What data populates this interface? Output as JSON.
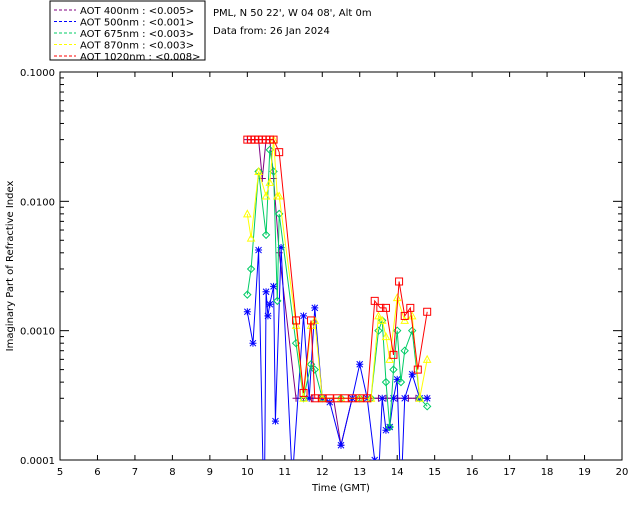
{
  "header": {
    "site_line": "PML, N 50 22', W 04 08', Alt 0m",
    "date_line": "Data from: 26 Jan 2024"
  },
  "legend": [
    {
      "label": "AOT  400nm : <0.005>",
      "color": "#800080"
    },
    {
      "label": "AOT  500nm : <0.001>",
      "color": "#0000ff"
    },
    {
      "label": "AOT  675nm : <0.003>",
      "color": "#00cc66"
    },
    {
      "label": "AOT  870nm : <0.003>",
      "color": "#ffff00"
    },
    {
      "label": "AOT 1020nm : <0.008>",
      "color": "#ff0000"
    }
  ],
  "chart_data": {
    "type": "line",
    "xlabel": "Time (GMT)",
    "ylabel": "Imaginary Part of Refractive Index",
    "x_scale": "linear",
    "y_scale": "log",
    "xlim": [
      5,
      20
    ],
    "ylim": [
      0.0001,
      0.1
    ],
    "x_ticks": [
      "5",
      "6",
      "7",
      "8",
      "9",
      "10",
      "11",
      "12",
      "13",
      "14",
      "15",
      "16",
      "17",
      "18",
      "19",
      "20"
    ],
    "y_ticks": [
      {
        "value": 0.1,
        "label": "0.1000"
      },
      {
        "value": 0.01,
        "label": "0.0100"
      },
      {
        "value": 0.001,
        "label": "0.0010"
      },
      {
        "value": 0.0001,
        "label": "0.0001"
      }
    ],
    "grid": false,
    "legend_position": "top-left, above plot",
    "series": [
      {
        "name": "AOT  400nm : <0.005>",
        "color": "#800080",
        "marker": "plus",
        "x": [
          10.0,
          10.1,
          10.2,
          10.3,
          10.4,
          10.5,
          10.6,
          10.7,
          10.85,
          11.3,
          11.5,
          11.75,
          12.0,
          12.3,
          12.5,
          12.8,
          13.0,
          13.3,
          13.5,
          13.7,
          14.0,
          14.3,
          14.5,
          14.8
        ],
        "y": [
          0.03,
          0.03,
          0.03,
          0.03,
          0.015,
          0.03,
          0.03,
          0.015,
          0.004,
          0.0003,
          0.0003,
          0.0003,
          0.0003,
          0.0003,
          0.00013,
          0.0003,
          0.0003,
          0.0003,
          0.0003,
          0.0003,
          0.0003,
          0.0003,
          0.0003,
          0.0003
        ]
      },
      {
        "name": "AOT  500nm : <0.001>",
        "color": "#0000ff",
        "marker": "asterisk",
        "x": [
          10.0,
          10.15,
          10.3,
          10.45,
          10.5,
          10.55,
          10.6,
          10.7,
          10.75,
          10.9,
          11.2,
          11.5,
          11.65,
          11.8,
          12.0,
          12.2,
          12.5,
          12.8,
          13.0,
          13.2,
          13.4,
          13.5,
          13.6,
          13.7,
          13.8,
          13.9,
          14.0,
          14.1,
          14.2,
          14.4,
          14.6,
          14.8
        ],
        "y": [
          0.0014,
          0.0008,
          0.0042,
          3e-05,
          0.002,
          0.0013,
          0.0016,
          0.0022,
          0.0002,
          0.0044,
          7e-05,
          0.0013,
          0.0003,
          0.0015,
          0.0003,
          0.00028,
          0.00013,
          0.0003,
          0.00055,
          0.0003,
          0.0001,
          7e-05,
          0.0003,
          0.00017,
          0.00018,
          0.0003,
          0.00042,
          5e-05,
          0.0003,
          0.00046,
          0.0003,
          0.0003
        ]
      },
      {
        "name": "AOT  675nm : <0.003>",
        "color": "#00cc66",
        "marker": "diamond",
        "x": [
          10.0,
          10.1,
          10.3,
          10.5,
          10.6,
          10.7,
          10.8,
          10.85,
          11.3,
          11.5,
          11.7,
          11.8,
          12.0,
          12.5,
          13.0,
          13.3,
          13.5,
          13.6,
          13.7,
          13.8,
          13.9,
          14.0,
          14.1,
          14.2,
          14.4,
          14.6,
          14.8
        ],
        "y": [
          0.0019,
          0.003,
          0.017,
          0.0055,
          0.025,
          0.017,
          0.0017,
          0.008,
          0.0008,
          0.0003,
          0.00055,
          0.0005,
          0.0003,
          0.0003,
          0.0003,
          0.0003,
          0.001,
          0.0012,
          0.0004,
          0.00018,
          0.0005,
          0.001,
          0.0004,
          0.0007,
          0.001,
          0.0003,
          0.00026
        ]
      },
      {
        "name": "AOT  870nm : <0.003>",
        "color": "#ffff00",
        "marker": "triangle",
        "x": [
          10.0,
          10.1,
          10.3,
          10.5,
          10.6,
          10.7,
          10.8,
          10.85,
          11.3,
          11.5,
          11.7,
          11.8,
          12.0,
          12.5,
          13.0,
          13.3,
          13.5,
          13.6,
          13.7,
          13.8,
          14.0,
          14.2,
          14.4,
          14.6,
          14.8
        ],
        "y": [
          0.008,
          0.0052,
          0.017,
          0.011,
          0.014,
          0.03,
          0.011,
          0.011,
          0.0011,
          0.0003,
          0.0011,
          0.0012,
          0.0003,
          0.0003,
          0.0003,
          0.0003,
          0.0013,
          0.0012,
          0.0009,
          0.0006,
          0.0018,
          0.0012,
          0.0013,
          0.0003,
          0.0006
        ]
      },
      {
        "name": "AOT 1020nm : <0.008>",
        "color": "#ff0000",
        "marker": "square",
        "x": [
          10.0,
          10.1,
          10.2,
          10.3,
          10.4,
          10.5,
          10.6,
          10.7,
          10.85,
          11.3,
          11.5,
          11.7,
          11.8,
          12.0,
          12.2,
          12.4,
          12.6,
          12.8,
          13.0,
          13.2,
          13.4,
          13.55,
          13.7,
          13.9,
          14.05,
          14.2,
          14.35,
          14.55,
          14.8
        ],
        "y": [
          0.03,
          0.03,
          0.03,
          0.03,
          0.03,
          0.03,
          0.03,
          0.03,
          0.024,
          0.0012,
          0.00033,
          0.0012,
          0.0003,
          0.0003,
          0.0003,
          0.0003,
          0.0003,
          0.0003,
          0.0003,
          0.0003,
          0.0017,
          0.0015,
          0.0015,
          0.00065,
          0.0024,
          0.0013,
          0.0015,
          0.0005,
          0.0014
        ]
      }
    ]
  }
}
